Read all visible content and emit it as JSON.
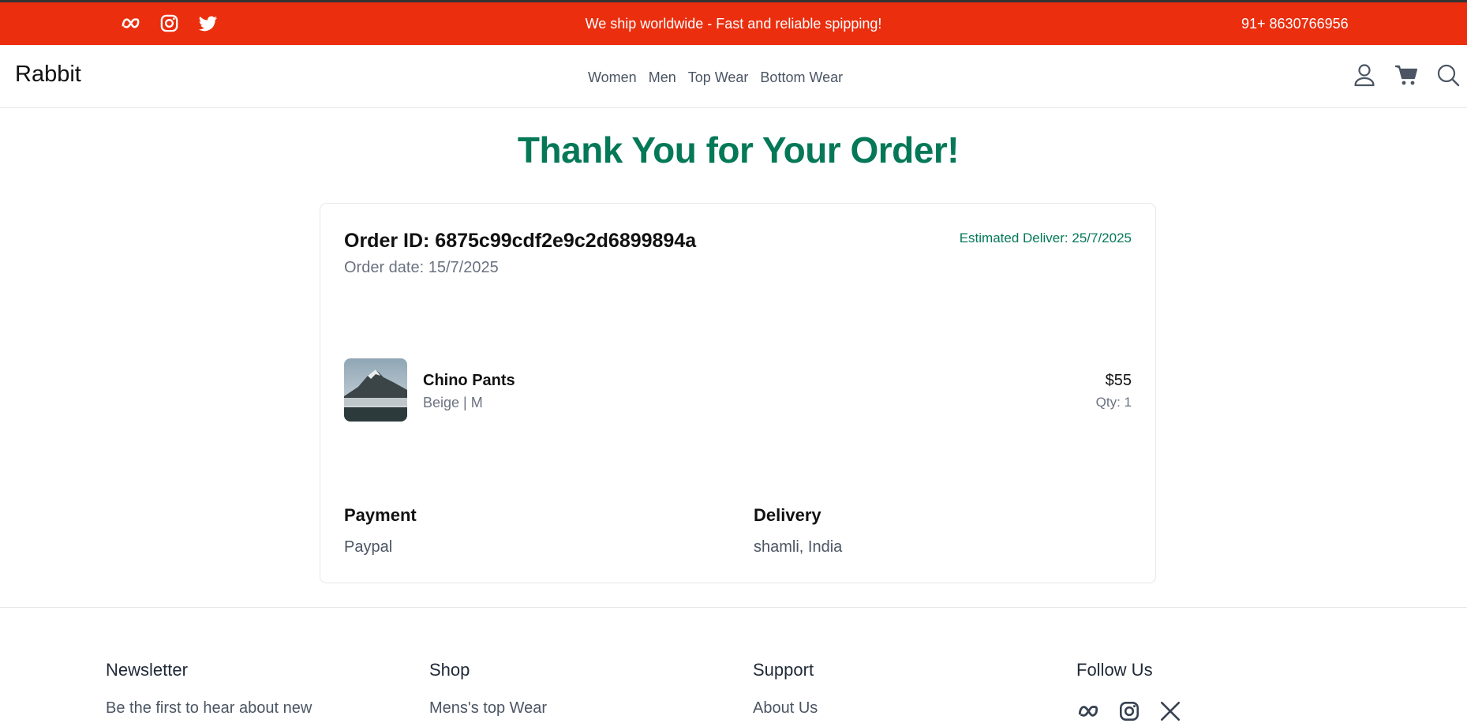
{
  "topbar": {
    "social_icons": [
      "meta-icon",
      "instagram-icon",
      "twitter-icon"
    ],
    "message": "We ship worldwide - Fast and reliable spipping!",
    "phone": "91+ 8630766956",
    "background": "#ea2e0e"
  },
  "nav": {
    "logo": "Rabbit",
    "links": [
      "Women",
      "Men",
      "Top Wear",
      "Bottom Wear"
    ],
    "icons": [
      "user-icon",
      "cart-icon",
      "search-icon"
    ]
  },
  "confirmation": {
    "title": "Thank You for Your Order!",
    "title_color": "#047857",
    "order_id": "Order ID: 6875c99cdf2e9c2d6899894a",
    "order_date": "Order date: 15/7/2025",
    "estimated_delivery": "Estimated Deliver: 25/7/2025",
    "item": {
      "name": "Chino Pants",
      "variant": "Beige | M",
      "price": "$55",
      "qty": "Qty: 1"
    },
    "payment": {
      "heading": "Payment",
      "value": "Paypal"
    },
    "delivery": {
      "heading": "Delivery",
      "value": "shamli, India"
    }
  },
  "footer": {
    "newsletter": {
      "heading": "Newsletter",
      "text": "Be the first to hear about new"
    },
    "shop": {
      "heading": "Shop",
      "first_link": "Mens's top Wear"
    },
    "support": {
      "heading": "Support",
      "first_link": "About Us"
    },
    "follow": {
      "heading": "Follow Us",
      "icons": [
        "meta-icon",
        "instagram-icon",
        "x-icon"
      ]
    }
  }
}
